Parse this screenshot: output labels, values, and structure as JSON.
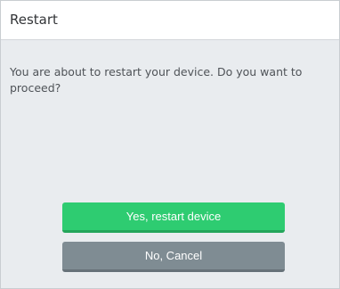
{
  "dialog": {
    "title": "Restart",
    "message": "You are about to restart your device. Do you want to proceed?",
    "confirm_label": "Yes, restart device",
    "cancel_label": "No, Cancel"
  },
  "colors": {
    "confirm": "#2ecc71",
    "cancel": "#7f8c93",
    "background": "#e9ecef"
  }
}
